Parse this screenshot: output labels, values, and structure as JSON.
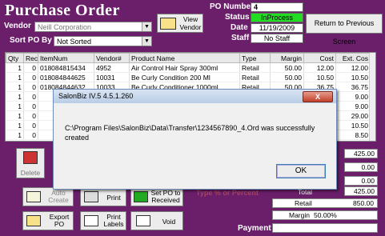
{
  "header": {
    "title": "Purchase Order",
    "vendor_label": "Vendor",
    "vendor_value": "Neill Corporation",
    "sort_label": "Sort PO By",
    "sort_value": "Not Sorted",
    "view_vendor_label": "View\nVendor",
    "po_number_label": "PO Number",
    "po_number_value": "4",
    "status_label": "Status",
    "status_value": "InProcess",
    "date_label": "Date",
    "date_value": "11/19/2009",
    "staff_label": "Staff",
    "staff_value": "No Staff",
    "return_button": "Return to Previous Screen"
  },
  "table": {
    "columns": [
      "Qty",
      "Rec",
      "ItemNum",
      "Vendor#",
      "Product Name",
      "Type",
      "Margin",
      "Cost",
      "Ext. Cos"
    ],
    "rows": [
      [
        "1",
        "0",
        "018084815434",
        "4952",
        "Air Control Hair Spray 300ml",
        "Retail",
        "50.00",
        "12.00",
        "12.00"
      ],
      [
        "1",
        "0",
        "018084844625",
        "10031",
        "Be Curly Condition 200 Ml",
        "Retail",
        "50.00",
        "10.50",
        "10.50"
      ],
      [
        "1",
        "0",
        "018084844632",
        "10033",
        "Be Curly Conditioner 1000ml",
        "Retail",
        "50.00",
        "36.75",
        "36.75"
      ],
      [
        "1",
        "0",
        "",
        "",
        "",
        "",
        "",
        "",
        "9.00"
      ],
      [
        "1",
        "0",
        "",
        "",
        "",
        "",
        "",
        "",
        "9.00"
      ],
      [
        "1",
        "0",
        "",
        "",
        "",
        "",
        "",
        "",
        "29.00"
      ],
      [
        "1",
        "0",
        "",
        "",
        "",
        "",
        "",
        "",
        "10.50"
      ],
      [
        "1",
        "0",
        "",
        "",
        "",
        "",
        "",
        "",
        "8.50"
      ]
    ]
  },
  "dialog": {
    "title": "SalonBiz IV.5 4.5.1.260",
    "close": "X",
    "message": "C:\\Program Files\\SalonBiz\\Data\\Transfer\\1234567890_4.Ord was successfully created",
    "ok": "OK"
  },
  "buttons": {
    "delete": "Delete",
    "auto_create": "Auto\nCreate",
    "print": "Print",
    "set_po_received": "Set PO to\nReceived",
    "export_po": "Export\nPO",
    "print_labels": "Print\nLabels",
    "void": "Void"
  },
  "totals": {
    "right_values": [
      "425.00",
      "0.00",
      "0.00",
      "425.00"
    ],
    "total_label": "Total",
    "retail_label": "Retail",
    "retail_value": "850.00",
    "margin_label": "Margin",
    "margin_value": "50.00%",
    "payment_label": "Payment",
    "type_percent": "Type % or Percent"
  },
  "colors": {
    "background": "#6b1f6b",
    "status_green": "#22dd22"
  }
}
